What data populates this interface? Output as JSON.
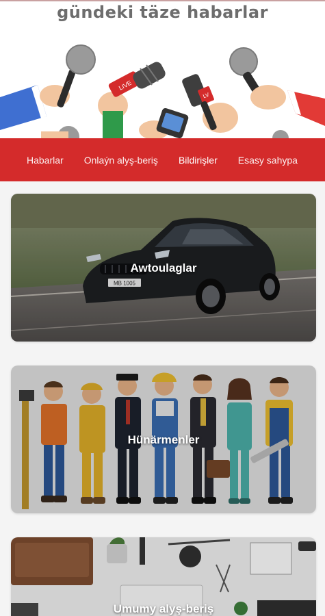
{
  "header": {
    "title": "gündeki täze habarlar",
    "mic_badges": [
      "LIVE",
      "LV"
    ]
  },
  "nav": {
    "items": [
      {
        "label": "Habarlar"
      },
      {
        "label": "Onlaýn alyş-beriş"
      },
      {
        "label": "Bildirişler"
      },
      {
        "label": "Esasy sahypa"
      }
    ]
  },
  "categories": [
    {
      "label": "Awtoulaglar",
      "image": "black-sedan-on-road"
    },
    {
      "label": "Hünärmenler",
      "image": "group-of-workers-illustration"
    },
    {
      "label": "Umumy alyş-beriş",
      "image": "tools-flatlay"
    }
  ],
  "car_plate": "MB 1005",
  "colors": {
    "accent": "#d42b2b",
    "title": "#6d6d6d",
    "background": "#f4f4f4"
  }
}
